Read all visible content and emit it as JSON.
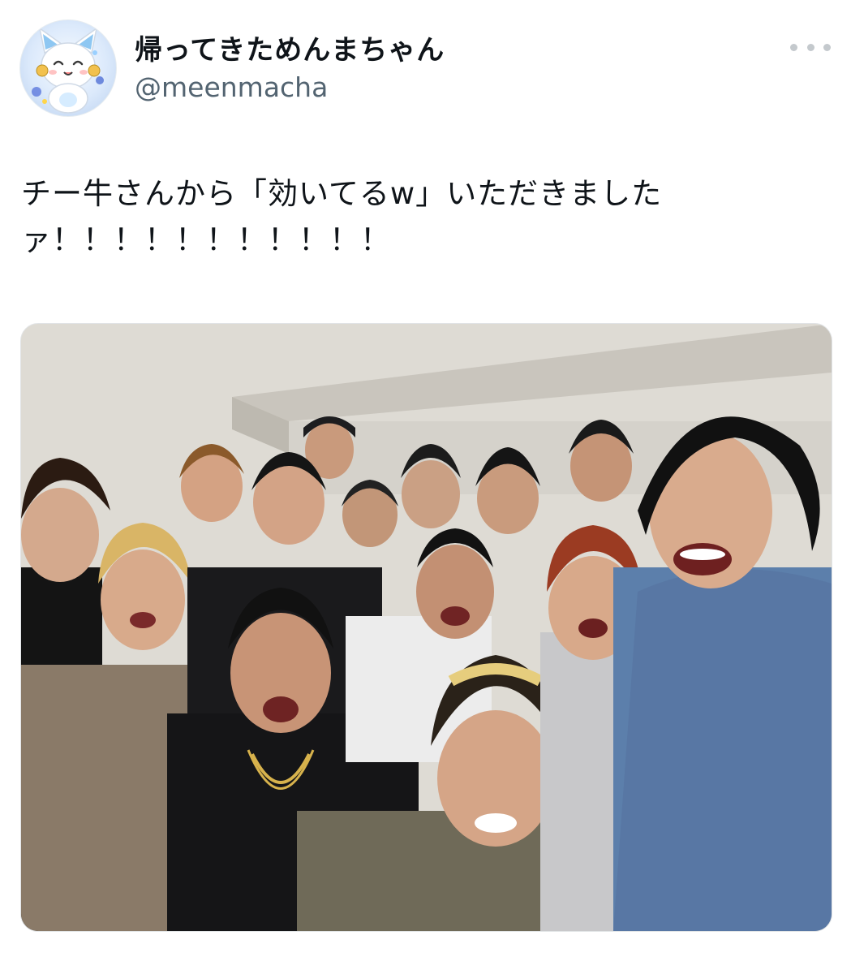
{
  "tweet": {
    "display_name": "帰ってきためんまちゃん",
    "handle": "@meenmacha",
    "text_lines": [
      "チー牛さんから「効いてるw」いただきました",
      "ァ！！！！！！！！！！！"
    ]
  },
  "icons": {
    "avatar": "avatar-cat-character",
    "more": "more-options-dots-icon"
  },
  "colors": {
    "text_primary": "#0f1419",
    "text_secondary": "#536471",
    "background": "#ffffff"
  }
}
